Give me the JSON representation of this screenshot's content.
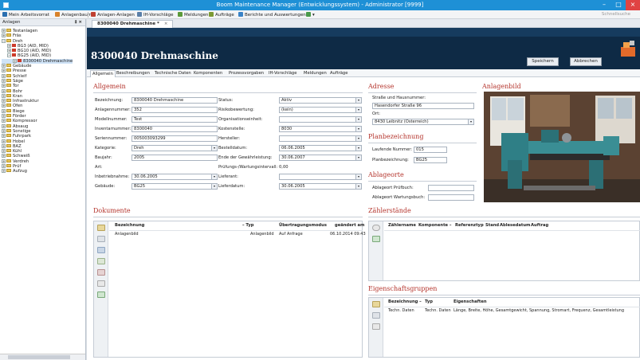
{
  "window": {
    "title": "Boom Maintenance Manager (Entwicklungssystem) - Administrator [9999]"
  },
  "menubar": {
    "items": [
      {
        "label": "Mein Arbeitsvorrat",
        "icon": "user-icon",
        "color": "#2a6fb0"
      },
      {
        "label": "Anlagenbaum",
        "icon": "tree-icon",
        "color": "#d8822a"
      },
      {
        "label": "Anlagen-Anlagen",
        "icon": "machine-icon",
        "color": "#c04030"
      },
      {
        "label": "IH-Vorschläge",
        "icon": "list-icon",
        "color": "#5a7fa8"
      },
      {
        "label": "Meldungen",
        "icon": "message-icon",
        "color": "#5b9a3a"
      },
      {
        "label": "Aufträge",
        "icon": "order-icon",
        "color": "#7c9a34"
      },
      {
        "label": "Berichte und Auswertungen",
        "icon": "report-icon",
        "color": "#3a83c7"
      }
    ],
    "search_placeholder": "Schnellsuche"
  },
  "left_panel": {
    "title": "Anlagen",
    "pin": "‡",
    "close": "×",
    "tree": [
      {
        "label": "Testanlagen",
        "level": 0,
        "exp": "+"
      },
      {
        "label": "Fräs",
        "level": 0,
        "exp": "+"
      },
      {
        "label": "Dreh",
        "level": 0,
        "exp": "−"
      },
      {
        "label": "BG3 (AID, MID)",
        "level": 1,
        "exp": "+",
        "red": true
      },
      {
        "label": "BG10 (AID, MID)",
        "level": 1,
        "exp": "+",
        "red": true
      },
      {
        "label": "BG25 (AID, MID)",
        "level": 1,
        "exp": "−",
        "red": true
      },
      {
        "label": "8300040 Drehmaschine",
        "level": 2,
        "exp": "+",
        "red": true,
        "selected": true
      },
      {
        "label": "Gebäude",
        "level": 0,
        "exp": "+"
      },
      {
        "label": "Presse",
        "level": 0,
        "exp": "+"
      },
      {
        "label": "Schleif",
        "level": 0,
        "exp": "+"
      },
      {
        "label": "Säge",
        "level": 0,
        "exp": "+"
      },
      {
        "label": "Tor",
        "level": 0,
        "exp": "+"
      },
      {
        "label": "Bohr",
        "level": 0,
        "exp": "+"
      },
      {
        "label": "Kran",
        "level": 0,
        "exp": "+"
      },
      {
        "label": "Infrastruktur",
        "level": 0,
        "exp": "+"
      },
      {
        "label": "Ofen",
        "level": 0,
        "exp": "+"
      },
      {
        "label": "Biege",
        "level": 0,
        "exp": "+"
      },
      {
        "label": "Förder",
        "level": 0,
        "exp": "+"
      },
      {
        "label": "Kompressor",
        "level": 0,
        "exp": "+"
      },
      {
        "label": "Absaug",
        "level": 0,
        "exp": "+"
      },
      {
        "label": "Sonstige",
        "level": 0,
        "exp": "+"
      },
      {
        "label": "Fuhrpark",
        "level": 0,
        "exp": "+"
      },
      {
        "label": "Hobel",
        "level": 0,
        "exp": "+"
      },
      {
        "label": "BAZ",
        "level": 0,
        "exp": "+"
      },
      {
        "label": "Kühl",
        "level": 0,
        "exp": "+"
      },
      {
        "label": "Schweiß",
        "level": 0,
        "exp": "+"
      },
      {
        "label": "Verdreh",
        "level": 0,
        "exp": "+"
      },
      {
        "label": "Prüf",
        "level": 0,
        "exp": "+"
      },
      {
        "label": "Aufzug",
        "level": 0,
        "exp": "+"
      }
    ]
  },
  "doc_tab": {
    "label": "8300040 Drehmaschine *",
    "close": "×"
  },
  "banner": {
    "title": "8300040 Drehmaschine",
    "save": "Speichern",
    "cancel": "Abbrechen"
  },
  "subtabs": [
    "Allgemein",
    "Beschreibungen",
    "Technische Daten",
    "Komponenten",
    "Prozessvorgaben",
    "IH-Vorschläge",
    "Meldungen",
    "Aufträge"
  ],
  "allgemein": {
    "heading": "Allgemein",
    "left": [
      {
        "label": "Bezeichnung:",
        "value": "8300040 Drehmaschine"
      },
      {
        "label": "Anlagennummer:",
        "value": "352"
      },
      {
        "label": "Modellnummer:",
        "value": "Test"
      },
      {
        "label": "Inventarnummer:",
        "value": "8300040"
      },
      {
        "label": "Seriennummer:",
        "value": "005003093299"
      },
      {
        "label": "Kategorie:",
        "value": "Dreh",
        "dropdown": true
      },
      {
        "label": "Baujahr:",
        "value": "2005"
      },
      {
        "label": "Art:",
        "value": "",
        "nobox": true
      },
      {
        "label": "Inbetriebnahme:",
        "value": "30.06.2005",
        "dropdown": true
      },
      {
        "label": "Gebäude:",
        "value": "BG25",
        "dropdown": true
      }
    ],
    "right": [
      {
        "label": "Status:",
        "value": "Aktiv",
        "dropdown": true
      },
      {
        "label": "Risikobewertung:",
        "value": "(kein)",
        "dropdown": true
      },
      {
        "label": "Organisationseinheit:",
        "value": "",
        "dropdown": true
      },
      {
        "label": "Kostenstelle:",
        "value": "8030",
        "dropdown": true
      },
      {
        "label": "Hersteller:",
        "value": "",
        "dropdown": true
      },
      {
        "label": "Bestelldatum:",
        "value": "06.06.2005",
        "dropdown": true
      },
      {
        "label": "Ende der Gewährleistung:",
        "value": "30.06.2007",
        "dropdown": true
      },
      {
        "label": "Prüfungs-/Wartungsintervall:",
        "value": "0,00",
        "nobox": true
      },
      {
        "label": "Lieferant:",
        "value": "",
        "dropdown": true
      },
      {
        "label": "Lieferdatum:",
        "value": "30.06.2005",
        "dropdown": true
      }
    ]
  },
  "adresse": {
    "heading": "Adresse",
    "street_label": "Straße und Hausnummer:",
    "street": "Hasendorfer Straße 96",
    "city_label": "Ort:",
    "city": "8430 Leibnitz (Österreich)"
  },
  "planbezeichnung": {
    "heading": "Planbezeichnung",
    "lfd_label": "Laufende Nummer:",
    "lfd": "015",
    "plan_label": "Planbezeichnung:",
    "plan": "BG25"
  },
  "ablageorte": {
    "heading": "Ablageorte",
    "pruef_label": "Ablageort Prüfbuch:",
    "pruef": "",
    "wartung_label": "Ablageort Wartungsbuch:",
    "wartung": ""
  },
  "anlagenbild": {
    "heading": "Anlagenbild"
  },
  "dokumente": {
    "heading": "Dokumente",
    "columns": [
      "Bezeichnung",
      "Typ",
      "Übertragungsmodus",
      "geändert am"
    ],
    "rows": [
      {
        "bezeichnung": "Anlagenbild",
        "typ": "Anlagenbild",
        "modus": "Auf Anfrage",
        "datum": "06.10.2014 09:43"
      }
    ]
  },
  "zaehlerstaende": {
    "heading": "Zählerstände",
    "columns": [
      "Zählername",
      "Komponente",
      "Referenztyp",
      "Stand",
      "Ablesedatum",
      "Auftrag"
    ]
  },
  "eigenschaftsgruppen": {
    "heading": "Eigenschaftsgruppen",
    "columns": [
      "Bezeichnung",
      "Typ",
      "Eigenschaften"
    ],
    "rows": [
      {
        "bezeichnung": "Techn. Daten",
        "typ": "Techn. Daten",
        "eigenschaften": "Länge, Breite, Höhe, Gesamtgewicht, Spannung, Stromart, Frequenz, Gesamtleistung"
      }
    ]
  },
  "colors": {
    "accent": "#1e90d6",
    "banner": "#0e2a45",
    "heading": "#b4342c"
  }
}
